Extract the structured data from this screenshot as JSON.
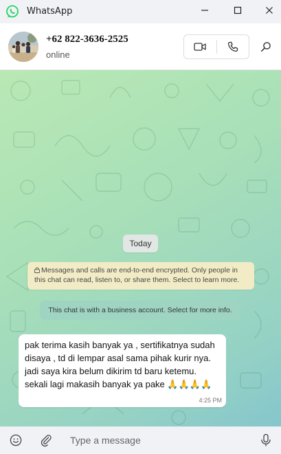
{
  "app": {
    "title": "WhatsApp",
    "icon": "whatsapp-logo"
  },
  "window_controls": [
    "minimize-icon",
    "maximize-icon",
    "close-icon"
  ],
  "header": {
    "contact_name": "+62 822-3636-2525",
    "status": "online",
    "actions": [
      "video-call-icon",
      "voice-call-icon",
      "search-icon"
    ]
  },
  "chat": {
    "date_label": "Today",
    "encryption_notice": "Messages and calls are end-to-end encrypted. Only people in this chat can read, listen to, or share them. Select to learn more.",
    "business_notice": "This chat is with a business account. Select for more info.",
    "messages": [
      {
        "direction": "incoming",
        "text": "pak terima kasih banyak ya , sertifikatnya sudah disaya , td di lempar asal sama pihak kurir nya. jadi saya kira belum dikirim td baru ketemu. sekali lagi makasih banyak ya pake 🙏🙏🙏🙏",
        "time": "4:25 PM"
      }
    ]
  },
  "composer": {
    "placeholder": "Type a message",
    "value": "",
    "icons": [
      "emoji-icon",
      "attach-icon",
      "microphone-icon"
    ]
  },
  "colors": {
    "brand_green": "#25d366",
    "chat_bg_start": "#b9e8b4",
    "chat_bg_end": "#86c6cc",
    "notice_yellow": "#f2ecc6",
    "bubble_incoming": "#ffffff"
  }
}
